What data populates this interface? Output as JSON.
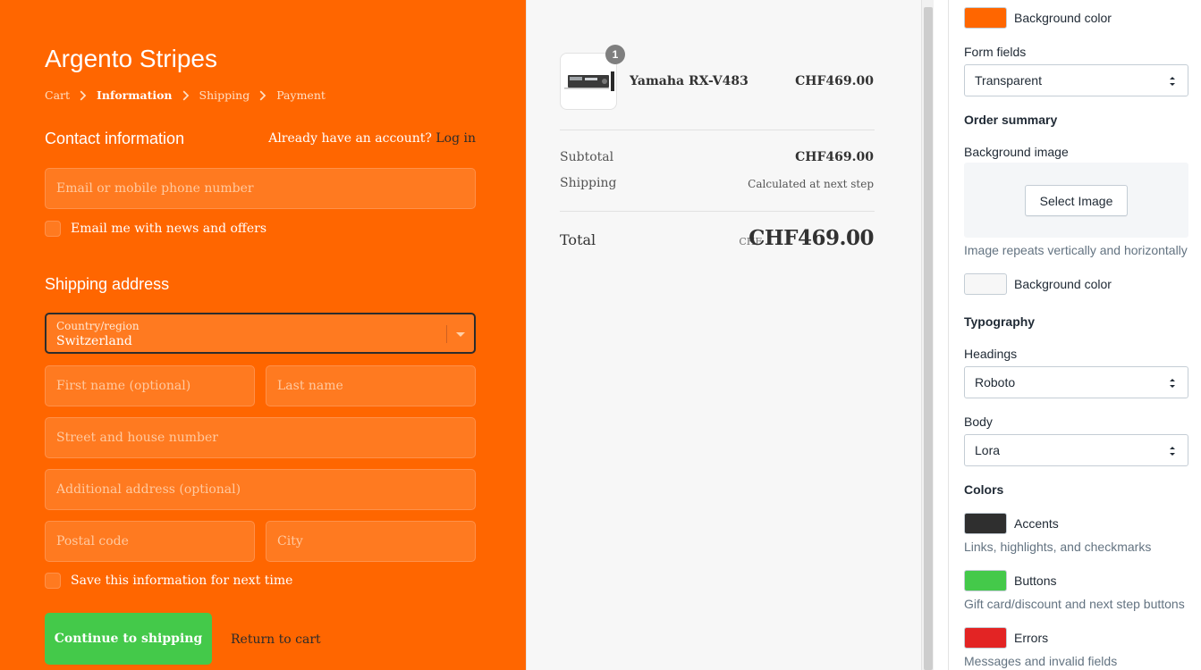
{
  "checkout": {
    "shop_name": "Argento Stripes",
    "breadcrumbs": [
      "Cart",
      "Information",
      "Shipping",
      "Payment"
    ],
    "contact_title": "Contact information",
    "account_prompt": "Already have an account?",
    "login_link": "Log in",
    "email_placeholder": "Email or mobile phone number",
    "newsletter_label": "Email me with news and offers",
    "shipping_title": "Shipping address",
    "country_label": "Country/region",
    "country_value": "Switzerland",
    "first_name_placeholder": "First name (optional)",
    "last_name_placeholder": "Last name",
    "street_placeholder": "Street and house number",
    "additional_placeholder": "Additional address (optional)",
    "postal_placeholder": "Postal code",
    "city_placeholder": "City",
    "save_info_label": "Save this information for next time",
    "continue_button": "Continue to shipping",
    "return_link": "Return to cart"
  },
  "summary": {
    "item_qty": "1",
    "item_name": "Yamaha RX-V483",
    "item_price": "CHF469.00",
    "subtotal_label": "Subtotal",
    "subtotal_value": "CHF469.00",
    "shipping_label": "Shipping",
    "shipping_value": "Calculated at next step",
    "total_label": "Total",
    "total_currency": "CHF",
    "total_value": "CHF469.00"
  },
  "settings": {
    "bg_color_label_top": "Background color",
    "form_fields_label": "Form fields",
    "form_fields_value": "Transparent",
    "order_summary_heading": "Order summary",
    "bg_image_label": "Background image",
    "select_image_button": "Select Image",
    "image_repeat_hint": "Image repeats vertically and horizontally",
    "bg_color_label_summary": "Background color",
    "typography_heading": "Typography",
    "headings_label": "Headings",
    "headings_value": "Roboto",
    "body_label": "Body",
    "body_value": "Lora",
    "colors_heading": "Colors",
    "accents_label": "Accents",
    "accents_hint": "Links, highlights, and checkmarks",
    "buttons_label": "Buttons",
    "buttons_hint": "Gift card/discount and next step buttons",
    "errors_label": "Errors",
    "errors_hint": "Messages and invalid fields"
  },
  "colors": {
    "checkout_background": "#ff6600",
    "summary_background": "#f7f7f7",
    "accent": "#2f2f2f",
    "button": "#44c94a",
    "error": "#e32424"
  }
}
